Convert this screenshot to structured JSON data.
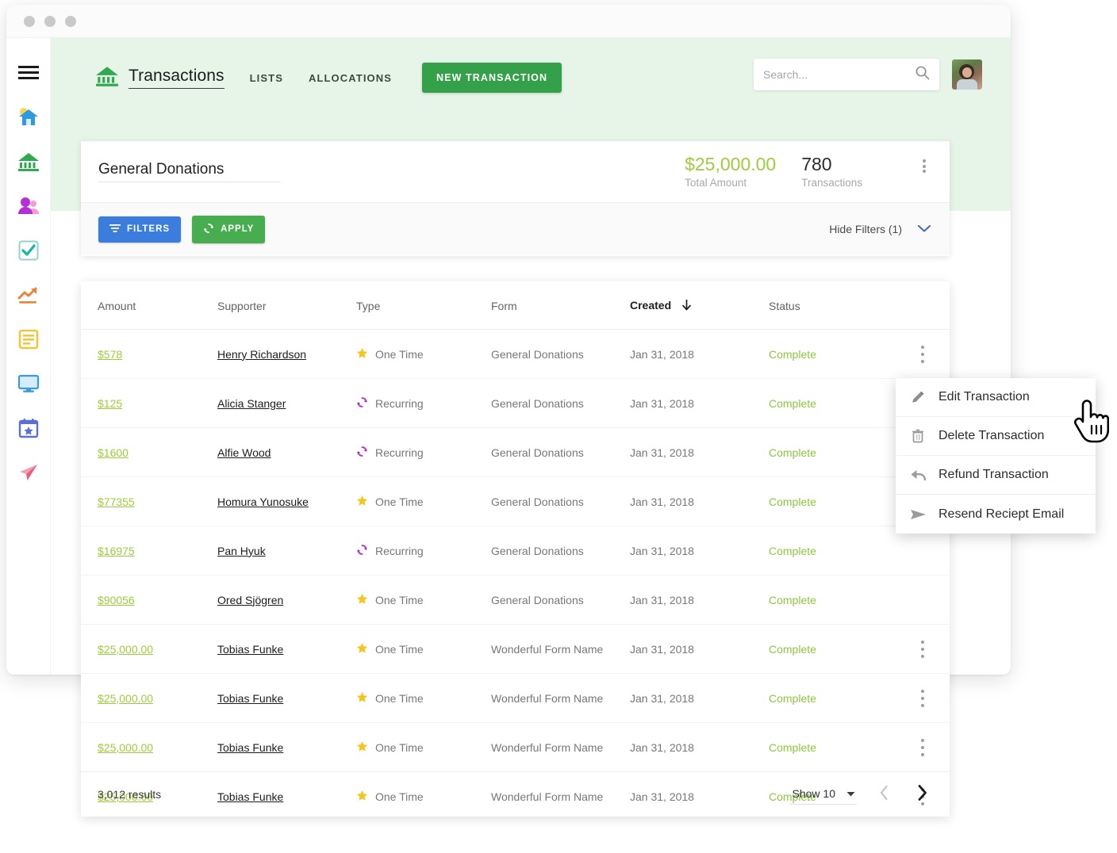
{
  "window": {
    "dots": [
      "close-dot",
      "minimize-dot",
      "maximize-dot"
    ]
  },
  "sidebar": {
    "items": [
      {
        "icon": "hamburger-menu-icon",
        "label": "Menu"
      },
      {
        "icon": "home-icon",
        "label": "Home"
      },
      {
        "icon": "bank-icon",
        "label": "Transactions"
      },
      {
        "icon": "people-icon",
        "label": "Supporters"
      },
      {
        "icon": "checkbox-icon",
        "label": "Tasks"
      },
      {
        "icon": "trending-up-icon",
        "label": "Reports"
      },
      {
        "icon": "document-list-icon",
        "label": "Forms"
      },
      {
        "icon": "monitor-icon",
        "label": "Website"
      },
      {
        "icon": "calendar-star-icon",
        "label": "Events"
      },
      {
        "icon": "paper-plane-icon",
        "label": "Campaigns"
      }
    ]
  },
  "header": {
    "brand_icon": "bank-icon",
    "title": "Transactions",
    "nav": [
      {
        "label": "LISTS"
      },
      {
        "label": "ALLOCATIONS"
      }
    ],
    "primary_button": "NEW TRANSACTION",
    "search": {
      "placeholder": "Search...",
      "value": "",
      "icon": "search-icon"
    },
    "avatar": "user-avatar"
  },
  "summary": {
    "list_name": "General Donations",
    "total_amount_value": "$25,000.00",
    "total_amount_label": "Total Amount",
    "transactions_value": "780",
    "transactions_label": "Transactions",
    "kebab": "more-options-icon",
    "filters_button": "FILTERS",
    "filters_icon": "filter-icon",
    "apply_button": "APPLY",
    "apply_icon": "refresh-icon",
    "hide_filters_label": "Hide Filters (1)",
    "hide_filters_icon": "chevron-down-icon"
  },
  "table": {
    "columns": [
      {
        "key": "amount",
        "label": "Amount",
        "sorted": false
      },
      {
        "key": "supporter",
        "label": "Supporter",
        "sorted": false
      },
      {
        "key": "type",
        "label": "Type",
        "sorted": false
      },
      {
        "key": "form",
        "label": "Form",
        "sorted": false
      },
      {
        "key": "created",
        "label": "Created",
        "sorted": true,
        "sort_icon": "arrow-down-icon"
      },
      {
        "key": "status",
        "label": "Status",
        "sorted": false
      }
    ],
    "rows": [
      {
        "amount": "$578",
        "supporter": "Henry Richardson",
        "type": "One Time",
        "type_icon": "star-icon",
        "form": "General Donations",
        "created": "Jan 31, 2018",
        "status": "Complete"
      },
      {
        "amount": "$125",
        "supporter": "Alicia Stanger",
        "type": "Recurring",
        "type_icon": "refresh-icon",
        "form": "General Donations",
        "created": "Jan 31, 2018",
        "status": "Complete"
      },
      {
        "amount": "$1600",
        "supporter": "Alfie Wood",
        "type": "Recurring",
        "type_icon": "refresh-icon",
        "form": "General Donations",
        "created": "Jan 31, 2018",
        "status": "Complete"
      },
      {
        "amount": "$77355",
        "supporter": "Homura Yunosuke",
        "type": "One Time",
        "type_icon": "star-icon",
        "form": "General Donations",
        "created": "Jan 31, 2018",
        "status": "Complete"
      },
      {
        "amount": "$16975",
        "supporter": "Pan Hyuk",
        "type": "Recurring",
        "type_icon": "refresh-icon",
        "form": "General Donations",
        "created": "Jan 31, 2018",
        "status": "Complete"
      },
      {
        "amount": "$90056",
        "supporter": "Ored Sjögren",
        "type": "One Time",
        "type_icon": "star-icon",
        "form": "General Donations",
        "created": "Jan 31, 2018",
        "status": "Complete"
      },
      {
        "amount": "$25,000.00",
        "supporter": "Tobias Funke",
        "type": "One Time",
        "type_icon": "star-icon",
        "form": "Wonderful Form Name",
        "created": "Jan 31, 2018",
        "status": "Complete"
      },
      {
        "amount": "$25,000.00",
        "supporter": "Tobias Funke",
        "type": "One Time",
        "type_icon": "star-icon",
        "form": "Wonderful Form Name",
        "created": "Jan 31, 2018",
        "status": "Complete"
      },
      {
        "amount": "$25,000.00",
        "supporter": "Tobias Funke",
        "type": "One Time",
        "type_icon": "star-icon",
        "form": "Wonderful Form Name",
        "created": "Jan 31, 2018",
        "status": "Complete"
      },
      {
        "amount": "$25,000.00",
        "supporter": "Tobias Funke",
        "type": "One Time",
        "type_icon": "star-icon",
        "form": "Wonderful Form Name",
        "created": "Jan 31, 2018",
        "status": "Complete"
      }
    ]
  },
  "footer": {
    "results": "3,012 results",
    "page_size_label": "Show 10",
    "page_size_icon": "caret-down-icon",
    "prev_icon": "chevron-left-icon",
    "next_icon": "chevron-right-icon"
  },
  "context_menu": {
    "items": [
      {
        "label": "Edit Transaction",
        "icon": "pencil-icon"
      },
      {
        "label": "Delete Transaction",
        "icon": "trash-icon"
      },
      {
        "label": "Refund Transaction",
        "icon": "reply-arrow-icon"
      },
      {
        "label": "Resend Reciept Email",
        "icon": "send-icon"
      }
    ]
  },
  "cursor": {
    "type": "pointing-hand-cursor"
  },
  "colors": {
    "header_bg": "#e6f5e7",
    "brand_green": "#34a049",
    "amount_green": "#9ccd3b",
    "status_green": "#8cc63f",
    "filters_blue": "#3b7ddd",
    "apply_green": "#47ad4e",
    "star_yellow": "#f5c518",
    "recurring_purple": "#b32fd0"
  }
}
